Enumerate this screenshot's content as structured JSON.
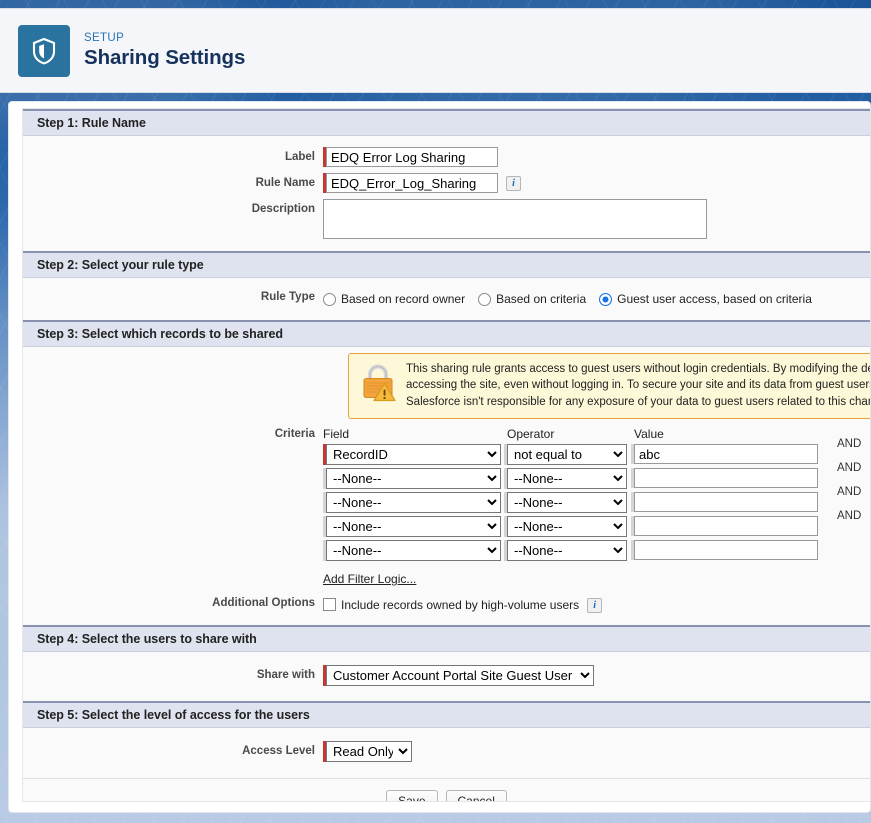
{
  "header": {
    "eyebrow": "SETUP",
    "title": "Sharing Settings",
    "badge_icon": "shield-icon"
  },
  "step1": {
    "heading": "Step 1: Rule Name",
    "label_label": "Label",
    "label_value": "EDQ Error Log Sharing",
    "rule_name_label": "Rule Name",
    "rule_name_value": "EDQ_Error_Log_Sharing",
    "rule_name_info": "i",
    "description_label": "Description",
    "description_value": ""
  },
  "step2": {
    "heading": "Step 2: Select your rule type",
    "rule_type_label": "Rule Type",
    "options": [
      {
        "label": "Based on record owner",
        "checked": false
      },
      {
        "label": "Based on criteria",
        "checked": false
      },
      {
        "label": "Guest user access, based on criteria",
        "checked": true
      }
    ]
  },
  "step3": {
    "heading": "Step 3: Select which records to be shared",
    "warning_icon": "padlock-warning-icon",
    "warning_line1": "This sharing rule grants access to guest users without login credentials. By modifying the defau",
    "warning_line2": "accessing the site, even without logging in. To secure your site and its data from guest users, c",
    "warning_line3": "Salesforce isn't responsible for any exposure of your data to guest users related to this change",
    "criteria_label": "Criteria",
    "col_field": "Field",
    "col_operator": "Operator",
    "col_value": "Value",
    "and_label": "AND",
    "rows": [
      {
        "field": "RecordID",
        "operator": "not equal to",
        "value": "abc",
        "required": true,
        "and": true
      },
      {
        "field": "--None--",
        "operator": "--None--",
        "value": "",
        "required": false,
        "and": true
      },
      {
        "field": "--None--",
        "operator": "--None--",
        "value": "",
        "required": false,
        "and": true
      },
      {
        "field": "--None--",
        "operator": "--None--",
        "value": "",
        "required": false,
        "and": true
      },
      {
        "field": "--None--",
        "operator": "--None--",
        "value": "",
        "required": false,
        "and": false
      }
    ],
    "add_filter_logic": "Add Filter Logic...",
    "additional_options_label": "Additional Options",
    "high_volume_label": "Include records owned by high-volume users",
    "high_volume_checked": false,
    "high_volume_info": "i"
  },
  "step4": {
    "heading": "Step 4: Select the users to share with",
    "share_with_label": "Share with",
    "share_with_value": "Customer Account Portal Site Guest User"
  },
  "step5": {
    "heading": "Step 5: Select the level of access for the users",
    "access_level_label": "Access Level",
    "access_level_value": "Read Only"
  },
  "footer": {
    "save_label": "Save",
    "cancel_label": "Cancel"
  }
}
